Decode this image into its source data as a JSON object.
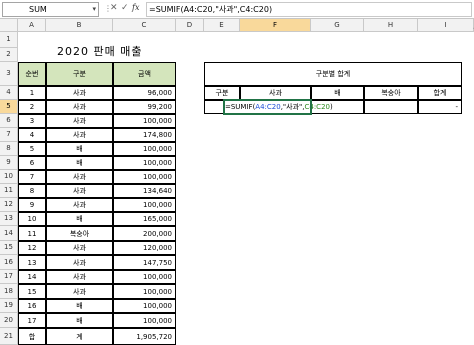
{
  "formula_bar": {
    "name_box": "SUM",
    "formula": "=SUMIF(A4:C20,\"사과\",C4:C20)"
  },
  "columns": [
    "A",
    "B",
    "C",
    "D",
    "E",
    "F",
    "G",
    "H",
    "I",
    "J"
  ],
  "rows": [
    "1",
    "2",
    "3",
    "4",
    "5",
    "6",
    "7",
    "8",
    "9",
    "10",
    "11",
    "12",
    "13",
    "14",
    "15",
    "16",
    "17",
    "18",
    "19",
    "20",
    "21"
  ],
  "sheet": {
    "title": "2020 판매 매출",
    "header": {
      "num": "순번",
      "category": "구분",
      "amount": "금액"
    },
    "data": [
      {
        "num": "1",
        "category": "사과",
        "amount": "96,000"
      },
      {
        "num": "2",
        "category": "사과",
        "amount": "99,200"
      },
      {
        "num": "3",
        "category": "사과",
        "amount": "100,000"
      },
      {
        "num": "4",
        "category": "사과",
        "amount": "174,800"
      },
      {
        "num": "5",
        "category": "배",
        "amount": "100,000"
      },
      {
        "num": "6",
        "category": "배",
        "amount": "100,000"
      },
      {
        "num": "7",
        "category": "사과",
        "amount": "100,000"
      },
      {
        "num": "8",
        "category": "사과",
        "amount": "134,640"
      },
      {
        "num": "9",
        "category": "사과",
        "amount": "100,000"
      },
      {
        "num": "10",
        "category": "배",
        "amount": "165,000"
      },
      {
        "num": "11",
        "category": "복숭아",
        "amount": "200,000"
      },
      {
        "num": "12",
        "category": "사과",
        "amount": "120,000"
      },
      {
        "num": "13",
        "category": "사과",
        "amount": "147,750"
      },
      {
        "num": "14",
        "category": "사과",
        "amount": "100,000"
      },
      {
        "num": "15",
        "category": "사과",
        "amount": "100,000"
      },
      {
        "num": "16",
        "category": "배",
        "amount": "100,000"
      },
      {
        "num": "17",
        "category": "배",
        "amount": "100,000"
      }
    ],
    "total": {
      "label1": "합",
      "label2": "계",
      "amount": "1,905,720"
    }
  },
  "summary": {
    "title": "구분별 합계",
    "headers": [
      "구분",
      "사과",
      "배",
      "복숭아",
      "합계"
    ],
    "edit_formula_prefix": "=SUMIF(",
    "edit_ref1": "A4:C20",
    "edit_criteria": ",\"사과\",",
    "edit_ref2": "C4:C20",
    "edit_suffix": ")",
    "total_value": "-"
  },
  "colors": {
    "header_fill": "#d4e5bc",
    "selection": "#217346",
    "ref1": "#1f4ed8",
    "ref2": "#2e8b20"
  }
}
